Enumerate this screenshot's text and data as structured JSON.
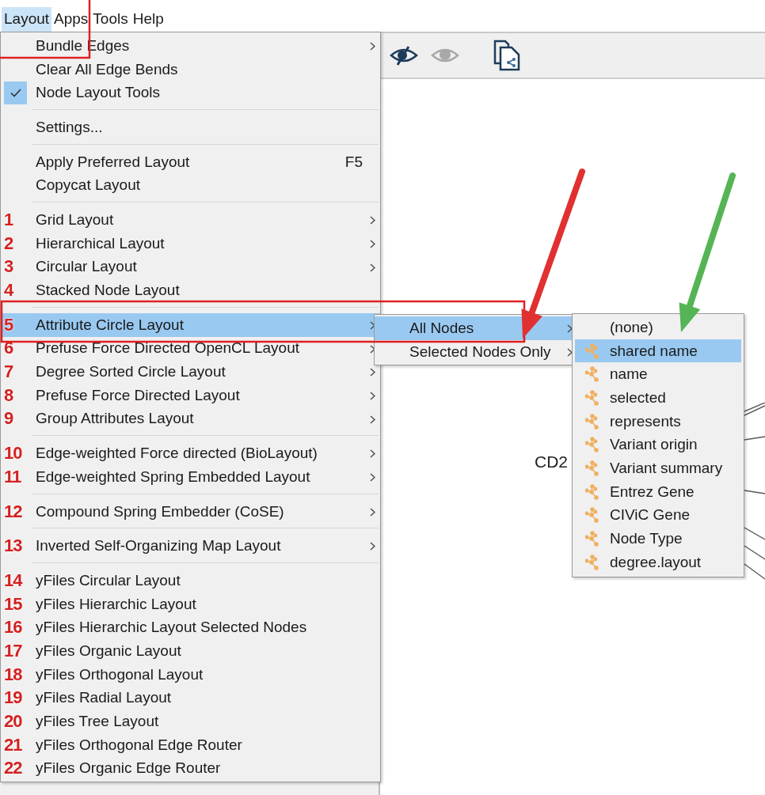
{
  "menubar": [
    {
      "label": "Layout",
      "selected": true
    },
    {
      "label": "Apps",
      "selected": false
    },
    {
      "label": "Tools",
      "selected": false
    },
    {
      "label": "Help",
      "selected": false
    }
  ],
  "layout_menu": {
    "groups": [
      [
        {
          "label": "Bundle Edges",
          "submenu": true,
          "checked": false,
          "selected": false
        },
        {
          "label": "Clear All Edge Bends",
          "submenu": false,
          "checked": false,
          "selected": false
        },
        {
          "label": "Node Layout Tools",
          "submenu": false,
          "checked": true,
          "selected": false
        }
      ],
      [
        {
          "label": "Settings...",
          "submenu": false,
          "selected": false
        }
      ],
      [
        {
          "label": "Apply Preferred Layout",
          "shortcut": "F5",
          "submenu": false,
          "selected": false
        },
        {
          "label": "Copycat Layout",
          "submenu": false,
          "selected": false
        }
      ],
      [
        {
          "number": "1",
          "label": "Grid Layout",
          "submenu": true,
          "selected": false
        },
        {
          "number": "2",
          "label": "Hierarchical Layout",
          "submenu": true,
          "selected": false
        },
        {
          "number": "3",
          "label": "Circular Layout",
          "submenu": true,
          "selected": false
        },
        {
          "number": "4",
          "label": "Stacked Node Layout",
          "submenu": false,
          "selected": false
        }
      ],
      [
        {
          "number": "5",
          "label": "Attribute Circle Layout",
          "submenu": true,
          "selected": true
        },
        {
          "number": "6",
          "label": "Prefuse Force Directed OpenCL Layout",
          "submenu": true,
          "selected": false
        },
        {
          "number": "7",
          "label": "Degree Sorted Circle Layout",
          "submenu": true,
          "selected": false
        },
        {
          "number": "8",
          "label": "Prefuse Force Directed Layout",
          "submenu": true,
          "selected": false
        },
        {
          "number": "9",
          "label": "Group Attributes Layout",
          "submenu": true,
          "selected": false
        }
      ],
      [
        {
          "number": "10",
          "label": "Edge-weighted Force directed (BioLayout)",
          "submenu": true,
          "selected": false
        },
        {
          "number": "11",
          "label": "Edge-weighted Spring Embedded Layout",
          "submenu": true,
          "selected": false
        }
      ],
      [
        {
          "number": "12",
          "label": "Compound Spring Embedder (CoSE)",
          "submenu": true,
          "selected": false
        }
      ],
      [
        {
          "number": "13",
          "label": "Inverted Self-Organizing Map Layout",
          "submenu": true,
          "selected": false
        }
      ],
      [
        {
          "number": "14",
          "label": "yFiles Circular Layout",
          "submenu": false,
          "selected": false
        },
        {
          "number": "15",
          "label": "yFiles Hierarchic Layout",
          "submenu": false,
          "selected": false
        },
        {
          "number": "16",
          "label": "yFiles Hierarchic Layout Selected Nodes",
          "submenu": false,
          "selected": false
        },
        {
          "number": "17",
          "label": "yFiles Organic Layout",
          "submenu": false,
          "selected": false
        },
        {
          "number": "18",
          "label": "yFiles Orthogonal Layout",
          "submenu": false,
          "selected": false
        },
        {
          "number": "19",
          "label": "yFiles Radial Layout",
          "submenu": false,
          "selected": false
        },
        {
          "number": "20",
          "label": "yFiles Tree Layout",
          "submenu": false,
          "selected": false
        },
        {
          "number": "21",
          "label": "yFiles Orthogonal Edge Router",
          "submenu": false,
          "selected": false
        },
        {
          "number": "22",
          "label": "yFiles Organic Edge Router",
          "submenu": false,
          "selected": false
        }
      ]
    ]
  },
  "nodes_submenu": [
    {
      "label": "All Nodes",
      "submenu": true,
      "selected": true
    },
    {
      "label": "Selected Nodes Only",
      "submenu": true,
      "selected": false
    }
  ],
  "attribute_submenu": [
    {
      "kind": "none",
      "label": "(none)",
      "selected": false
    },
    {
      "kind": "column",
      "label": "shared name",
      "selected": true
    },
    {
      "kind": "column",
      "label": "name",
      "selected": false
    },
    {
      "kind": "column",
      "label": "selected",
      "selected": false
    },
    {
      "kind": "column",
      "label": "represents",
      "selected": false
    },
    {
      "kind": "column",
      "label": "Variant origin",
      "selected": false
    },
    {
      "kind": "column",
      "label": "Variant summary",
      "selected": false
    },
    {
      "kind": "column",
      "label": "Entrez Gene",
      "selected": false
    },
    {
      "kind": "column",
      "label": "CIViC Gene",
      "selected": false
    },
    {
      "kind": "column",
      "label": "Node Type",
      "selected": false
    },
    {
      "kind": "column",
      "label": "degree.layout",
      "selected": false
    }
  ],
  "canvas": {
    "node_label": "CD2"
  },
  "arrows": [
    {
      "color": "#e03030"
    },
    {
      "color": "#55b455"
    }
  ]
}
